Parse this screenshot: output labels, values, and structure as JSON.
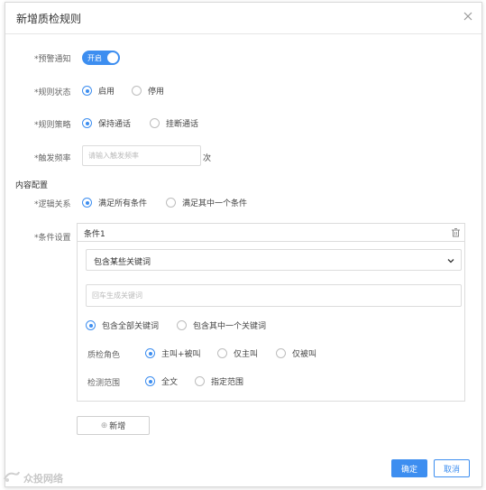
{
  "dialog": {
    "title": "新增质检规则"
  },
  "fields": {
    "alert": {
      "label": "*预警通知",
      "switch_text": "开启"
    },
    "status": {
      "label": "*规则状态",
      "options": [
        "启用",
        "停用"
      ],
      "selected": "启用"
    },
    "strategy": {
      "label": "*规则策略",
      "options": [
        "保持通话",
        "挂断通话"
      ],
      "selected": "保持通话"
    },
    "frequency": {
      "label": "*触发频率",
      "placeholder": "请输入触发频率",
      "unit": "次"
    }
  },
  "content_section": {
    "title": "内容配置"
  },
  "logic": {
    "label": "*逻辑关系",
    "options": [
      "满足所有条件",
      "满足其中一个条件"
    ],
    "selected": "满足所有条件"
  },
  "conditions": {
    "label": "*条件设置",
    "items": [
      {
        "title": "条件1",
        "select_value": "包含某些关键词",
        "keyword_placeholder": "回车生成关键词",
        "match_options": [
          "包含全部关键词",
          "包含其中一个关键词"
        ],
        "match_selected": "包含全部关键词",
        "role_label": "质检角色",
        "role_options": [
          "主叫+被叫",
          "仅主叫",
          "仅被叫"
        ],
        "role_selected": "主叫+被叫",
        "scope_label": "检测范围",
        "scope_options": [
          "全文",
          "指定范围"
        ],
        "scope_selected": "全文"
      }
    ],
    "add_label": "新增",
    "add_icon": "plus-icon"
  },
  "footer": {
    "confirm_label": "确定",
    "cancel_label": "取消"
  },
  "watermark": {
    "text": "众投网络"
  },
  "colors": {
    "accent": "#3d8ef0",
    "required": "#f56c6c",
    "border": "#dcdcdc"
  }
}
